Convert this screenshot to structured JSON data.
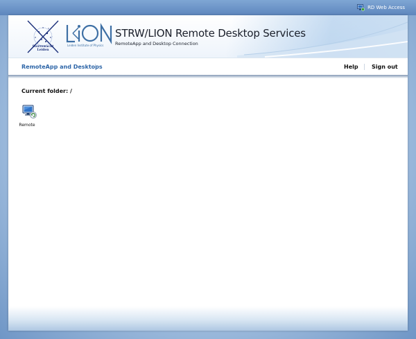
{
  "top_bar": {
    "rd_web_access_label": "RD Web Access",
    "rd_icon": "remote-desktop-icon"
  },
  "banner": {
    "logo_text_lines": [
      "Sterrewacht",
      "Leiden"
    ],
    "lion_logo_text": "LION",
    "lion_subtitle": "Leiden Institute of Physics",
    "title": "STRW/LION Remote Desktop Services",
    "subtitle": "RemoteApp and Desktop Connection"
  },
  "nav": {
    "left_tab": "RemoteApp and Desktops",
    "help": "Help",
    "sign_out": "Sign out"
  },
  "content": {
    "current_folder": "Current folder: /",
    "apps": [
      {
        "label": "Remote",
        "icon": "remote-desktop-computer-icon"
      }
    ]
  },
  "colors": {
    "accent": "#2e66a8",
    "top_bar": "#6e96c8"
  }
}
